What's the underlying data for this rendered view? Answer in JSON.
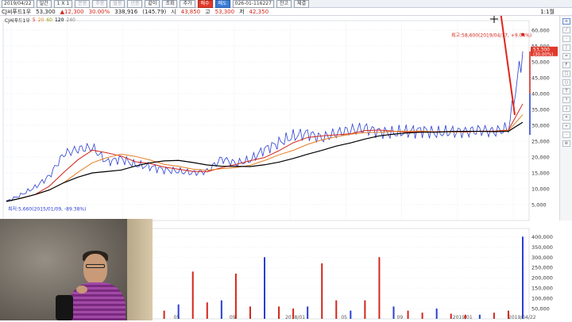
{
  "toolbar": {
    "date": "2019/04/22",
    "period_label": "일간",
    "interval": "1 X 1",
    "disabled_buttons": [
      "분봉",
      "주봉",
      "월봉",
      "년봉"
    ],
    "btn_compare": "같이",
    "btn_lookup": "조회",
    "btn_add": "추가",
    "btn_sell": "매수",
    "btn_buy": "매도",
    "account": "026-01-116227",
    "btn_settle": "잔고",
    "btn_check": "체결"
  },
  "infobar": {
    "name": "CJ씨푸드1우",
    "price": "53,300",
    "change": "▲12,300",
    "change_pct": "30.00%",
    "volume": "338,916",
    "vol_ratio": "(145.79)",
    "open_label": "시",
    "open": "43,850",
    "high_label": "고",
    "high": "53,300",
    "low_label": "저",
    "low": "42,350",
    "scale_label": "1:1월"
  },
  "legend": {
    "name": "CJ씨푸드1우",
    "ma": [
      "5",
      "20",
      "60",
      "120",
      "240"
    ]
  },
  "chart_data": {
    "type": "line",
    "price_axis_ticks": [
      5000,
      10000,
      15000,
      20000,
      25000,
      30000,
      35000,
      40000,
      45000,
      50000,
      55000,
      60000
    ],
    "price_axis_labels": [
      "5,000",
      "10,000",
      "15,000",
      "20,000",
      "25,000",
      "30,000",
      "35,000",
      "40,000",
      "45,000",
      "50,000",
      "55,000",
      "60,000"
    ],
    "volume_axis_labels": [
      "50,000",
      "100,000",
      "150,000",
      "200,000",
      "250,000",
      "300,000",
      "350,000",
      "400,000"
    ],
    "x_labels": [
      "05",
      "09",
      "2017/01",
      "05",
      "09",
      "2018/01",
      "05",
      "09",
      "2019/01",
      "2019/04/22"
    ],
    "high_annotation": "최고:58,600(2019/04/17, +9.04%)",
    "low_annotation": "최저:5,660(2015/01/09, -89.38%)",
    "current_price_label": "53,300",
    "current_change_label": "(30.00%)",
    "price_series_close": [
      6000,
      8000,
      10500,
      14000,
      21000,
      22500,
      23000,
      18500,
      19500,
      17500,
      17000,
      16000,
      15500,
      15000,
      15500,
      19500,
      18000,
      19000,
      22500,
      24500,
      26500,
      27500,
      26000,
      27500,
      28500,
      29000,
      28000,
      27500,
      28000,
      28500,
      27500,
      28000,
      28000,
      28500,
      28000,
      29000,
      53300
    ],
    "volume_series": [
      220000,
      160000,
      60000,
      40000,
      80000,
      30000,
      50000,
      40000,
      30000,
      60000,
      120000,
      40000,
      70000,
      230000,
      80000,
      90000,
      220000,
      60000,
      300000,
      60000,
      50000,
      60000,
      270000,
      90000,
      40000,
      90000,
      300000,
      60000,
      40000,
      30000,
      50000,
      25000,
      20000,
      20000,
      30000,
      40000,
      400000
    ]
  }
}
